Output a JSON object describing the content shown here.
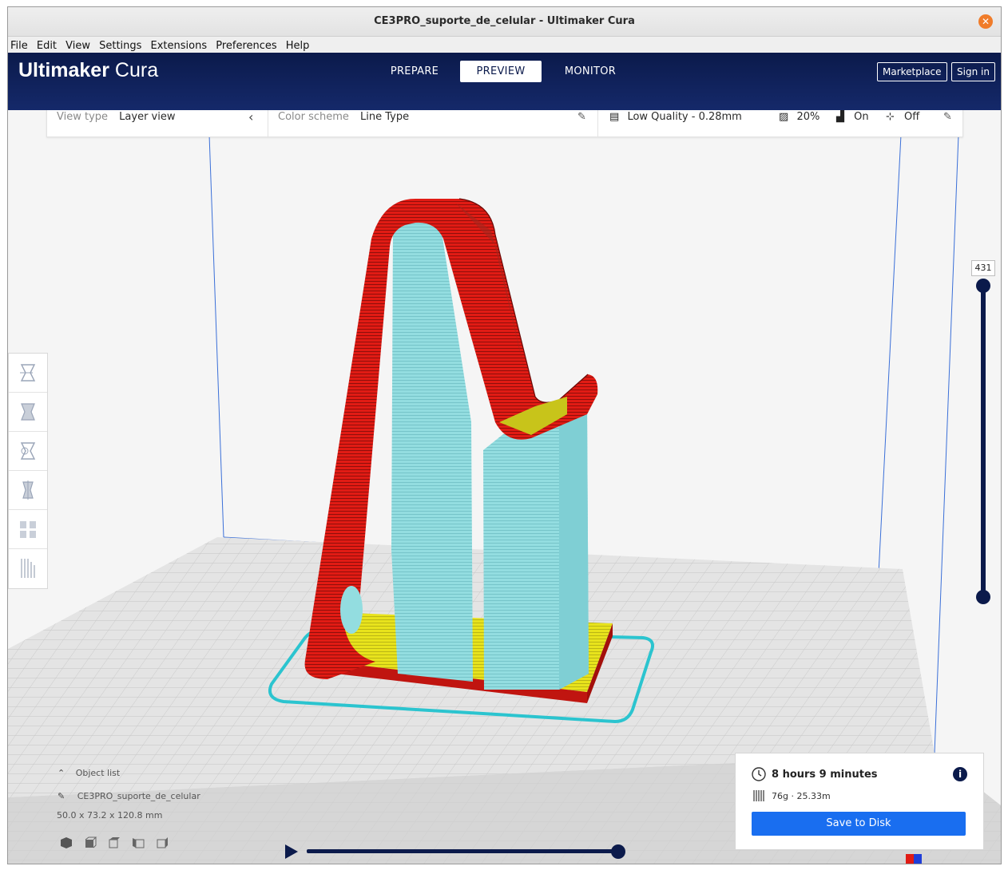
{
  "window": {
    "title": "CE3PRO_suporte_de_celular - Ultimaker Cura"
  },
  "menu": [
    "File",
    "Edit",
    "View",
    "Settings",
    "Extensions",
    "Preferences",
    "Help"
  ],
  "header": {
    "logo_bold": "Ultimaker",
    "logo_light": "Cura",
    "tabs": [
      "PREPARE",
      "PREVIEW",
      "MONITOR"
    ],
    "active_tab": "PREVIEW",
    "marketplace": "Marketplace",
    "signin": "Sign in"
  },
  "toolbar": {
    "view_type_label": "View type",
    "view_type_value": "Layer view",
    "color_scheme_label": "Color scheme",
    "color_scheme_value": "Line Type",
    "profile": "Low Quality - 0.28mm",
    "infill": "20%",
    "support": "On",
    "adhesion": "Off"
  },
  "layer_slider": {
    "value": "431"
  },
  "object": {
    "list_label": "Object list",
    "name": "CE3PRO_suporte_de_celular",
    "dimensions": "50.0 x 73.2 x 120.8 mm"
  },
  "print_info": {
    "time": "8 hours 9 minutes",
    "material": "76g · 25.33m",
    "save": "Save to Disk"
  },
  "colors": {
    "accent": "#196ef0",
    "header": "#0b1a4b",
    "wall": "#e11b14",
    "support": "#8fd9dc",
    "infill": "#e8e31c",
    "skirt": "#2bc4cf"
  }
}
